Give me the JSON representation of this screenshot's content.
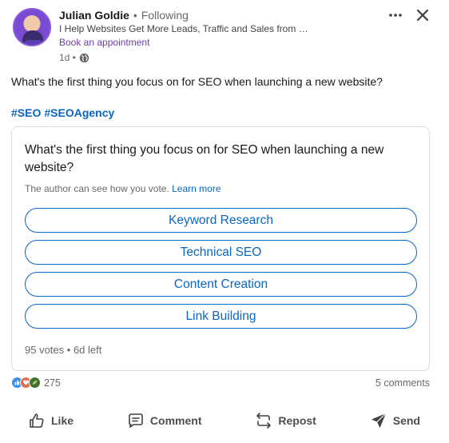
{
  "author": {
    "name": "Julian Goldie",
    "separator": "•",
    "follow_status": "Following",
    "headline": "I Help Websites Get More Leads, Traffic and Sales from Go...",
    "cta": "Book an appointment",
    "time": "1d •",
    "visibility_icon": "globe-icon"
  },
  "post": {
    "text": "What's the first thing you focus on for SEO when launching a new website?",
    "hashtags": [
      "#SEO",
      "#SEOAgency"
    ]
  },
  "poll": {
    "question": "What's the first thing you focus on for SEO when launching a new website?",
    "note": "The author can see how you vote.",
    "learn_more": "Learn more",
    "options": [
      "Keyword Research",
      "Technical SEO",
      "Content Creation",
      "Link Building"
    ],
    "votes": "95 votes",
    "time_left": "• 6d left"
  },
  "social": {
    "reaction_icons": [
      "like-reaction-icon",
      "love-reaction-icon",
      "support-reaction-icon"
    ],
    "reaction_count": "275",
    "comments": "5 comments"
  },
  "actions": {
    "like": "Like",
    "comment": "Comment",
    "repost": "Repost",
    "send": "Send"
  },
  "colors": {
    "link_blue": "#0a66c2",
    "cta_purple": "#6b3fa0",
    "like_blue": "#378fe9",
    "love_red": "#df704d",
    "support_green": "#44712e"
  }
}
